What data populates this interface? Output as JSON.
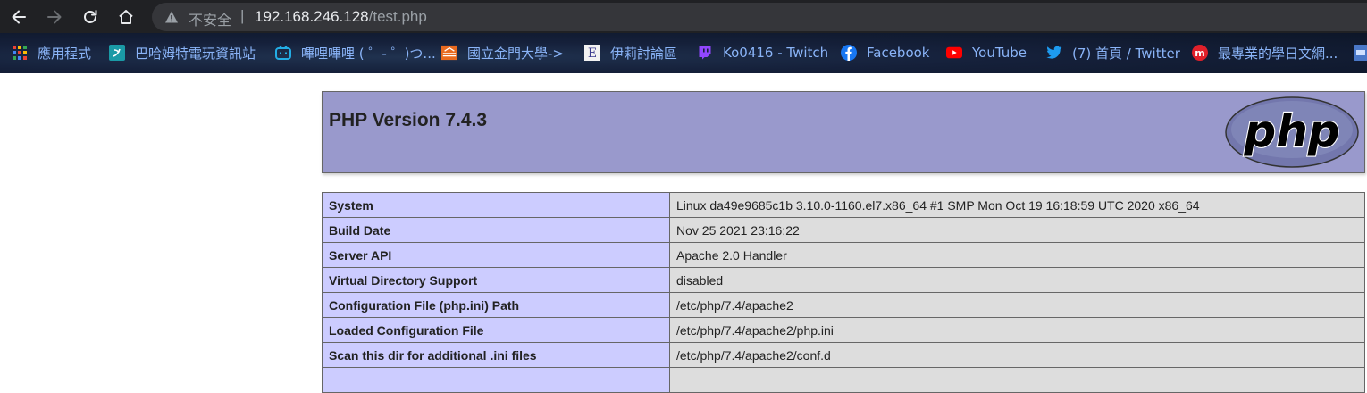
{
  "browser": {
    "insecure_label": "不安全",
    "separator": "|",
    "url_host": "192.168.246.128",
    "url_path": "/test.php"
  },
  "bookmarks": [
    {
      "label": "應用程式",
      "icon": "apps-grid-icon"
    },
    {
      "label": "巴哈姆特電玩資訊站",
      "icon": "bahamut-icon"
    },
    {
      "label": "嗶哩嗶哩 ( ゜- ゜)つ...",
      "icon": "bilibili-icon"
    },
    {
      "label": "國立金門大學->",
      "icon": "nqu-icon"
    },
    {
      "label": "伊莉討論區",
      "icon": "eyny-icon"
    },
    {
      "label": "Ko0416 - Twitch",
      "icon": "twitch-icon"
    },
    {
      "label": "Facebook",
      "icon": "facebook-icon"
    },
    {
      "label": "YouTube",
      "icon": "youtube-icon"
    },
    {
      "label": "(7) 首頁 / Twitter",
      "icon": "twitter-icon"
    },
    {
      "label": "最專業的學日文網...",
      "icon": "marumaru-icon"
    }
  ],
  "php": {
    "title": "PHP Version 7.4.3",
    "logo_text": "php"
  },
  "info_rows": [
    {
      "key": "System",
      "value": "Linux da49e9685c1b 3.10.0-1160.el7.x86_64 #1 SMP Mon Oct 19 16:18:59 UTC 2020 x86_64"
    },
    {
      "key": "Build Date",
      "value": "Nov 25 2021 23:16:22"
    },
    {
      "key": "Server API",
      "value": "Apache 2.0 Handler"
    },
    {
      "key": "Virtual Directory Support",
      "value": "disabled"
    },
    {
      "key": "Configuration File (php.ini) Path",
      "value": "/etc/php/7.4/apache2"
    },
    {
      "key": "Loaded Configuration File",
      "value": "/etc/php/7.4/apache2/php.ini"
    },
    {
      "key": "Scan this dir for additional .ini files",
      "value": "/etc/php/7.4/apache2/conf.d"
    },
    {
      "key": "",
      "value": ""
    }
  ],
  "colors": {
    "header_bg": "#9999cc",
    "key_bg": "#ccccff",
    "value_bg": "#dddddd",
    "link": "#8ab4f8"
  }
}
